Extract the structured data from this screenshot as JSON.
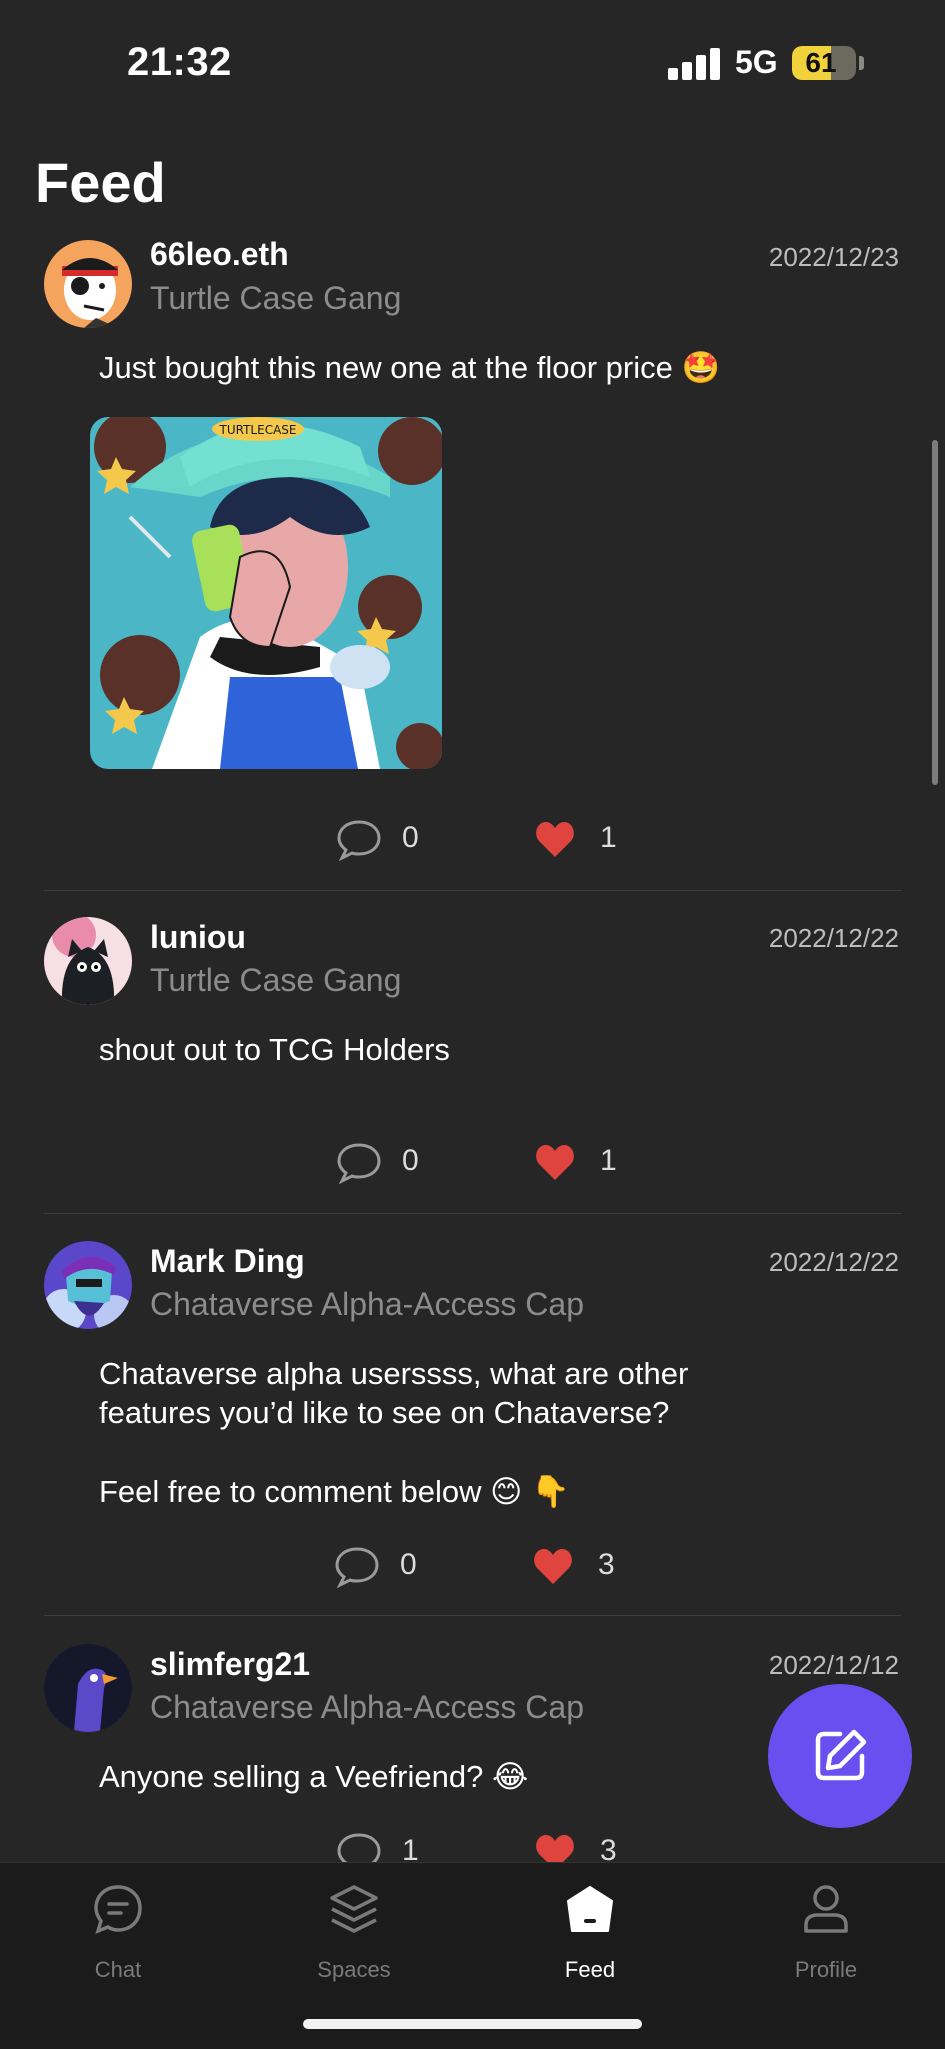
{
  "status_bar": {
    "time": "21:32",
    "network": "5G",
    "battery": "61",
    "battery_level": 0.61
  },
  "header": {
    "title": "Feed"
  },
  "posts": [
    {
      "username": "66leo.eth",
      "community": "Turtle Case Gang",
      "date": "2022/12/23",
      "text": "Just bought this new one at the floor price 🤩",
      "image_text": "TURTLECASE",
      "comments": "0",
      "likes": "1"
    },
    {
      "username": "luniou",
      "community": "Turtle Case Gang",
      "date": "2022/12/22",
      "text": "shout out to TCG Holders",
      "comments": "0",
      "likes": "1"
    },
    {
      "username": "Mark Ding",
      "community": "Chataverse Alpha-Access Cap",
      "date": "2022/12/22",
      "text_line1": "Chataverse alpha userssss, what are other",
      "text_line2": "features you’d like to see on Chataverse?",
      "text_line3": "Feel free to comment below 😊 👇",
      "comments": "0",
      "likes": "3"
    },
    {
      "username": "slimferg21",
      "community": "Chataverse Alpha-Access Cap",
      "date": "2022/12/12",
      "text": "Anyone selling a Veefriend? 😂",
      "comments": "1",
      "likes": "3"
    }
  ],
  "fab": {
    "icon": "compose-icon"
  },
  "tabs": [
    {
      "label": "Chat",
      "icon": "chat-bubble-icon"
    },
    {
      "label": "Spaces",
      "icon": "layers-icon"
    },
    {
      "label": "Feed",
      "icon": "home-icon"
    },
    {
      "label": "Profile",
      "icon": "person-icon"
    }
  ],
  "colors": {
    "accent": "#6a4ff0",
    "like": "#e0443e",
    "background": "#262626"
  }
}
